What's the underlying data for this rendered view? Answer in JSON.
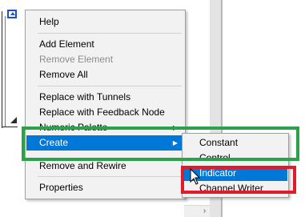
{
  "menu": {
    "items": [
      {
        "label": "Help",
        "disabled": false
      },
      {
        "label": "Add Element",
        "disabled": false
      },
      {
        "label": "Remove Element",
        "disabled": true
      },
      {
        "label": "Remove All",
        "disabled": false
      },
      {
        "label": "Replace with Tunnels",
        "disabled": false
      },
      {
        "label": "Replace with Feedback Node",
        "disabled": false
      },
      {
        "label": "Numeric Palette",
        "disabled": false,
        "has_submenu": true
      },
      {
        "label": "Create",
        "disabled": false,
        "has_submenu": true,
        "highlighted": true
      },
      {
        "label": "Remove and Rewire",
        "disabled": false
      },
      {
        "label": "Properties",
        "disabled": false
      }
    ]
  },
  "submenu": {
    "items": [
      {
        "label": "Constant",
        "highlighted": false
      },
      {
        "label": "Control",
        "highlighted": false
      },
      {
        "label": "Indicator",
        "highlighted": true
      },
      {
        "label": "Channel Writer",
        "highlighted": false
      }
    ]
  },
  "icons": {
    "submenu_arrow": "▶",
    "scroll_right": "›"
  },
  "colors": {
    "highlight": "#0078d7",
    "annotation_green": "#2aa24a",
    "annotation_red": "#e21b2b"
  }
}
